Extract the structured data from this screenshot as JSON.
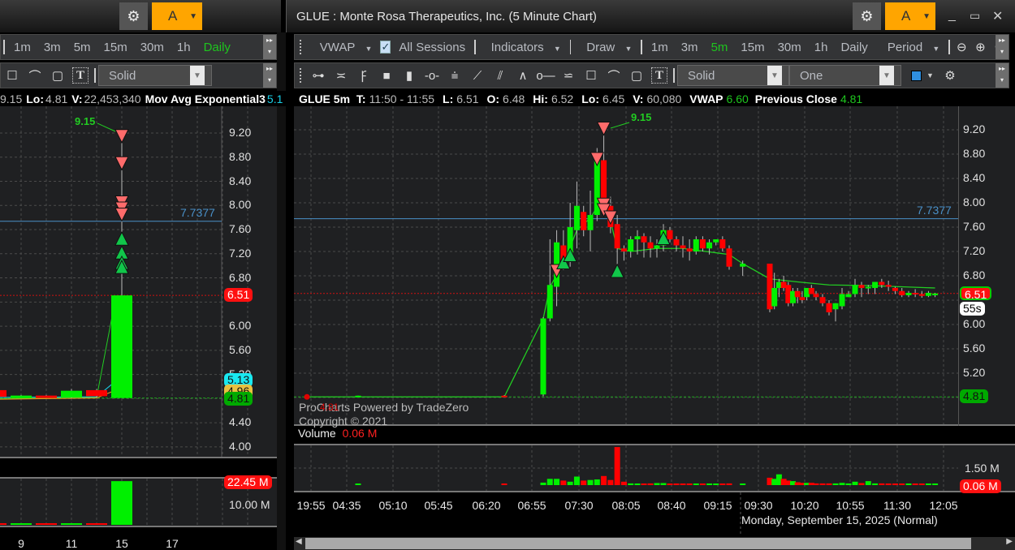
{
  "left_panel": {
    "toolbar_timeframes": [
      {
        "label": "1m"
      },
      {
        "label": "3m"
      },
      {
        "label": "5m"
      },
      {
        "label": "15m"
      },
      {
        "label": "30m"
      },
      {
        "label": "1h"
      },
      {
        "label": "Daily",
        "active": true
      }
    ],
    "line_style": "Solid",
    "account_button": "A",
    "info": {
      "hi_value": "9.15",
      "lo_label": "Lo:",
      "lo": "4.81",
      "v_label": "V:",
      "v": "22,453,340",
      "indicator": "Mov Avg Exponential3",
      "indicator_value": "5.1"
    },
    "price_axis": [
      "9.20",
      "8.80",
      "8.40",
      "8.00",
      "7.60",
      "7.20",
      "6.80",
      "6.00",
      "5.60",
      "5.20",
      "4.40",
      "4.00"
    ],
    "line_label": "7.7377",
    "high_label": "9.15",
    "badges": {
      "last": "6.51",
      "ema1": "5.13",
      "ema2": "4.96",
      "prev_close": "4.81"
    },
    "volume_axis": "10.00 M",
    "volume_badge": "22.45 M",
    "x_labels": [
      "9",
      "11",
      "15",
      "17"
    ],
    "candles": [
      [
        "8",
        4.94,
        4.96,
        4.82,
        4.83,
        0.3
      ],
      [
        "9",
        4.83,
        4.86,
        4.81,
        4.85,
        0.3
      ],
      [
        "10",
        4.85,
        4.86,
        4.81,
        4.82,
        0.3
      ],
      [
        "11",
        4.82,
        4.96,
        4.81,
        4.93,
        0.3
      ],
      [
        "12",
        4.94,
        4.96,
        4.82,
        4.84,
        0.3
      ],
      [
        "15",
        4.81,
        9.15,
        4.81,
        6.51,
        22.45
      ]
    ],
    "sell_markers": [
      9.15,
      8.7,
      8.05,
      7.95,
      7.85
    ],
    "buy_markers": [
      7.45,
      7.22,
      7.05,
      6.98
    ]
  },
  "main_panel": {
    "title": "GLUE : Monte Rosa Therapeutics, Inc. (5 Minute Chart)",
    "account_button": "A",
    "toolbar1": {
      "vwap": "VWAP",
      "sessions": "All Sessions",
      "indicators": "Indicators",
      "draw": "Draw",
      "period": "Period",
      "timeframes": [
        {
          "label": "1m"
        },
        {
          "label": "3m"
        },
        {
          "label": "5m",
          "active": true
        },
        {
          "label": "15m"
        },
        {
          "label": "30m"
        },
        {
          "label": "1h"
        },
        {
          "label": "Daily"
        }
      ]
    },
    "toolbar2": {
      "line_style": "Solid",
      "line_width": "One",
      "color": "#2f8fe0"
    },
    "info": {
      "symbol": "GLUE 5m",
      "t_label": "T:",
      "t": "11:50 - 11:55",
      "l_label": "L:",
      "l": "6.51",
      "o_label": "O:",
      "o": "6.48",
      "hi_label": "Hi:",
      "hi": "6.52",
      "lo_label": "Lo:",
      "lo": "6.45",
      "v_label": "V:",
      "v": "60,080",
      "vwap_label": "VWAP",
      "vwap": "6.60",
      "pc_label": "Previous Close",
      "pc": "4.81"
    },
    "price_axis": [
      "9.20",
      "8.80",
      "8.40",
      "8.00",
      "7.60",
      "7.20",
      "6.80",
      "6.00",
      "5.60",
      "5.20"
    ],
    "line_label": "7.7377",
    "line_price": 7.7377,
    "high_label": "9.15",
    "badges": {
      "last": "6.51",
      "timer": "55s",
      "prev_close": "4.81"
    },
    "prev_close_small": "4.81",
    "watermark": "ProCharts Powered by TradeZero",
    "copyright": "Copyright © 2021",
    "volume_label": "Volume",
    "volume_value": "0.06 M",
    "volume_axis": "1.50 M",
    "volume_badge": "0.06 M",
    "time_axis": [
      "19:55",
      "04:35",
      "05:10",
      "05:45",
      "06:20",
      "06:55",
      "07:30",
      "08:05",
      "08:40",
      "09:15",
      "09:30",
      "10:20",
      "10:55",
      "11:30",
      "12:05"
    ],
    "date_label": "Monday, September 15, 2025 (Normal)",
    "colors": {
      "up": "#00f000",
      "down": "#ff0000",
      "vwap": "#22cc22",
      "line": "#4a90c8"
    },
    "candles": [
      [
        "04:35",
        4.82,
        4.83,
        4.81,
        4.83,
        0.05
      ],
      [
        "06:25",
        4.83,
        4.84,
        4.81,
        4.81,
        0.04
      ],
      [
        "06:55",
        4.85,
        6.12,
        4.82,
        6.1,
        0.22
      ],
      [
        "07:00",
        6.1,
        7.4,
        6.05,
        6.65,
        0.55
      ],
      [
        "07:05",
        6.62,
        7.55,
        6.3,
        7.35,
        0.55
      ],
      [
        "07:10",
        7.3,
        7.55,
        6.9,
        7.05,
        0.4
      ],
      [
        "07:15",
        7.1,
        8.0,
        6.95,
        7.6,
        0.3
      ],
      [
        "07:20",
        7.55,
        8.35,
        7.25,
        7.95,
        0.75
      ],
      [
        "07:25",
        7.85,
        7.95,
        7.45,
        7.55,
        0.4
      ],
      [
        "07:30",
        7.55,
        8.2,
        7.2,
        7.8,
        0.45
      ],
      [
        "07:35",
        7.8,
        8.9,
        7.7,
        8.7,
        0.5
      ],
      [
        "07:40",
        8.7,
        9.15,
        7.8,
        7.9,
        0.8
      ],
      [
        "07:45",
        7.95,
        8.1,
        7.5,
        7.6,
        0.45
      ],
      [
        "07:50",
        7.65,
        7.8,
        6.95,
        7.25,
        3.35
      ],
      [
        "07:55",
        7.25,
        7.3,
        7.05,
        7.2,
        0.3
      ],
      [
        "08:00",
        7.2,
        7.45,
        7.1,
        7.4,
        0.15
      ],
      [
        "08:05",
        7.4,
        7.55,
        7.15,
        7.45,
        0.12
      ],
      [
        "08:10",
        7.45,
        7.5,
        7.1,
        7.35,
        0.12
      ],
      [
        "08:15",
        7.35,
        7.45,
        7.1,
        7.25,
        0.15
      ],
      [
        "08:20",
        7.25,
        7.4,
        7.1,
        7.3,
        0.18
      ],
      [
        "08:25",
        7.3,
        7.65,
        7.2,
        7.55,
        0.18
      ],
      [
        "08:30",
        7.55,
        7.6,
        7.35,
        7.4,
        0.12
      ],
      [
        "08:35",
        7.4,
        7.45,
        7.2,
        7.3,
        0.12
      ],
      [
        "08:40",
        7.3,
        7.45,
        7.1,
        7.25,
        0.12
      ],
      [
        "08:45",
        7.25,
        7.4,
        7.05,
        7.2,
        0.1
      ],
      [
        "08:50",
        7.2,
        7.45,
        7.15,
        7.4,
        0.1
      ],
      [
        "08:55",
        7.4,
        7.45,
        7.2,
        7.25,
        0.1
      ],
      [
        "09:00",
        7.25,
        7.4,
        7.15,
        7.35,
        0.1
      ],
      [
        "09:05",
        7.35,
        7.4,
        7.3,
        7.4,
        0.1
      ],
      [
        "09:10",
        7.4,
        7.45,
        7.2,
        7.25,
        0.12
      ],
      [
        "09:15",
        7.25,
        7.3,
        6.9,
        6.95,
        0.15
      ],
      [
        "09:20",
        6.95,
        7.05,
        6.8,
        7.0,
        0.12
      ],
      [
        "09:30",
        7.0,
        7.0,
        6.2,
        6.25,
        0.65
      ],
      [
        "09:35",
        6.3,
        6.85,
        6.25,
        6.6,
        0.55
      ],
      [
        "09:40",
        6.6,
        6.75,
        6.45,
        6.7,
        0.95
      ],
      [
        "09:45",
        6.7,
        6.8,
        6.55,
        6.6,
        0.55
      ],
      [
        "09:50",
        6.65,
        6.7,
        6.3,
        6.35,
        0.4
      ],
      [
        "09:55",
        6.35,
        6.6,
        6.3,
        6.55,
        0.35
      ],
      [
        "10:00",
        6.55,
        6.6,
        6.35,
        6.45,
        0.25
      ],
      [
        "10:05",
        6.45,
        6.55,
        6.35,
        6.4,
        0.2
      ],
      [
        "10:10",
        6.45,
        6.6,
        6.4,
        6.6,
        0.2
      ],
      [
        "10:15",
        6.6,
        6.65,
        6.5,
        6.5,
        0.2
      ],
      [
        "10:20",
        6.5,
        6.55,
        6.4,
        6.45,
        0.15
      ],
      [
        "10:25",
        6.45,
        6.5,
        6.3,
        6.35,
        0.15
      ],
      [
        "10:30",
        6.35,
        6.4,
        6.15,
        6.2,
        0.15
      ],
      [
        "10:35",
        6.25,
        6.35,
        6.05,
        6.35,
        0.15
      ],
      [
        "10:40",
        6.3,
        6.6,
        6.25,
        6.5,
        0.2
      ],
      [
        "10:45",
        6.45,
        6.55,
        6.45,
        6.5,
        0.15
      ],
      [
        "10:50",
        6.5,
        6.75,
        6.45,
        6.65,
        0.3
      ],
      [
        "10:55",
        6.65,
        6.7,
        6.45,
        6.6,
        0.18
      ],
      [
        "11:00",
        6.6,
        6.65,
        6.5,
        6.62,
        0.35
      ],
      [
        "11:05",
        6.6,
        6.7,
        6.5,
        6.7,
        0.15
      ],
      [
        "11:10",
        6.7,
        6.75,
        6.6,
        6.65,
        0.15
      ],
      [
        "11:15",
        6.65,
        6.72,
        6.55,
        6.62,
        0.12
      ],
      [
        "11:20",
        6.6,
        6.62,
        6.5,
        6.55,
        0.12
      ],
      [
        "11:25",
        6.55,
        6.6,
        6.45,
        6.48,
        0.1
      ],
      [
        "11:30",
        6.48,
        6.55,
        6.45,
        6.52,
        0.1
      ],
      [
        "11:35",
        6.52,
        6.58,
        6.45,
        6.5,
        0.08
      ],
      [
        "11:40",
        6.5,
        6.55,
        6.44,
        6.47,
        0.08
      ],
      [
        "11:45",
        6.47,
        6.55,
        6.45,
        6.52,
        0.08
      ],
      [
        "11:50",
        6.48,
        6.52,
        6.45,
        6.51,
        0.06
      ]
    ],
    "vwap_line": [
      [
        "06:25",
        4.81
      ],
      [
        "06:55",
        6.1
      ],
      [
        "07:00",
        6.62
      ],
      [
        "07:10",
        7.0
      ],
      [
        "07:20",
        7.55
      ],
      [
        "07:30",
        7.75
      ],
      [
        "07:40",
        8.1
      ],
      [
        "07:45",
        7.7
      ],
      [
        "07:50",
        7.25
      ],
      [
        "08:00",
        7.2
      ],
      [
        "08:20",
        7.25
      ],
      [
        "08:40",
        7.25
      ],
      [
        "09:15",
        7.15
      ],
      [
        "09:20",
        7.0
      ],
      [
        "09:30",
        6.75
      ],
      [
        "10:00",
        6.7
      ],
      [
        "10:30",
        6.65
      ],
      [
        "11:00",
        6.64
      ],
      [
        "11:50",
        6.6
      ]
    ],
    "sell_markers": [
      [
        "07:40",
        9.22
      ],
      [
        "07:35",
        8.72
      ],
      [
        "07:40",
        7.97
      ],
      [
        "07:40",
        7.88
      ],
      [
        "07:45",
        7.76
      ],
      [
        "07:05",
        6.88
      ]
    ],
    "buy_markers": [
      [
        "07:10",
        7.02
      ],
      [
        "07:15",
        7.14
      ],
      [
        "07:50",
        6.88
      ],
      [
        "08:25",
        7.42
      ]
    ]
  }
}
